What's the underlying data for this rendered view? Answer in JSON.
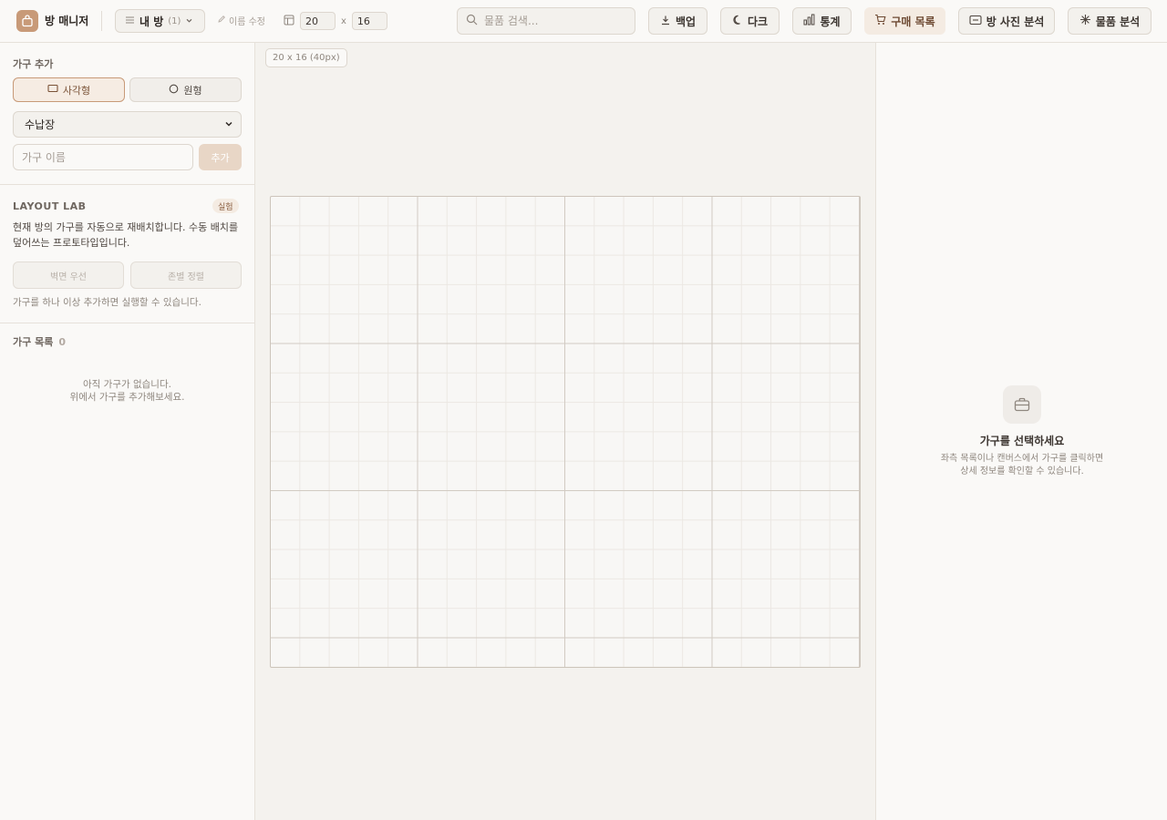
{
  "header": {
    "app_title": "방 매니저",
    "room_select": {
      "name": "내 방",
      "count": "(1)"
    },
    "rename_label": "이름 수정",
    "width_value": "20",
    "height_value": "16",
    "dim_separator": "x",
    "search_placeholder": "물품 검색...",
    "buttons": {
      "backup": "백업",
      "dark": "다크",
      "stats": "통계",
      "cart": "구매 목록",
      "photo": "방 사진 분석",
      "items": "물품 분석"
    }
  },
  "sidebar": {
    "add_section_label": "가구 추가",
    "shape_rect": "사각형",
    "shape_circle": "원형",
    "type_selected": "수납장",
    "name_placeholder": "가구 이름",
    "add_button": "추가",
    "layout_lab": {
      "title": "LAYOUT LAB",
      "badge": "실험",
      "description": "현재 방의 가구를 자동으로 재배치합니다. 수동 배치를 덮어쓰는 프로토타입입니다.",
      "btn_wall": "벽면 우선",
      "btn_zone": "존별 정렬",
      "note": "가구를 하나 이상 추가하면 실행할 수 있습니다."
    },
    "list": {
      "title": "가구 목록",
      "count": "0",
      "empty_line1": "아직 가구가 없습니다.",
      "empty_line2": "위에서 가구를 추가해보세요."
    }
  },
  "canvas": {
    "size_label": "20 x 16 (40px)"
  },
  "detail_panel": {
    "title": "가구를 선택하세요",
    "desc_line1": "좌측 목록이나 캔버스에서 가구를 클릭하면",
    "desc_line2": "상세 정보를 확인할 수 있습니다."
  },
  "colors": {
    "accent": "#c89a78",
    "background": "#f4f2ee",
    "panel": "#faf9f7"
  },
  "icons": {
    "logo": "bag-icon",
    "room_menu": "list-icon",
    "rename": "pencil-icon",
    "dimensions": "layout-icon",
    "search": "search-icon",
    "backup": "download-icon",
    "dark": "moon-icon",
    "stats": "bar-chart-icon",
    "cart": "cart-icon",
    "photo": "image-icon",
    "items": "sparkle-icon",
    "detail": "briefcase-icon"
  }
}
